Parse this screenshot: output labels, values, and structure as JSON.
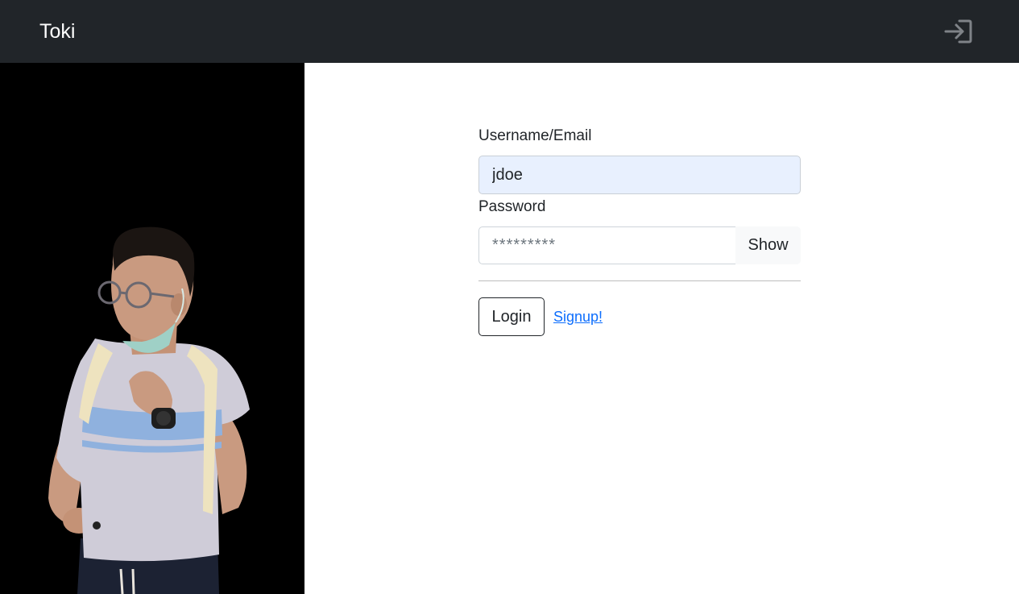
{
  "navbar": {
    "brand": "Toki",
    "login_icon": "login-arrow-icon"
  },
  "side_panel": {
    "image": "person-photo"
  },
  "form": {
    "username_label": "Username/Email",
    "username_value": "jdoe",
    "password_label": "Password",
    "password_placeholder": "*********",
    "show_label": "Show",
    "login_label": "Login",
    "signup_label": "Signup!"
  },
  "colors": {
    "navbar_bg": "#212529",
    "autofill_bg": "#e8f0fe",
    "link": "#0d6efd"
  }
}
